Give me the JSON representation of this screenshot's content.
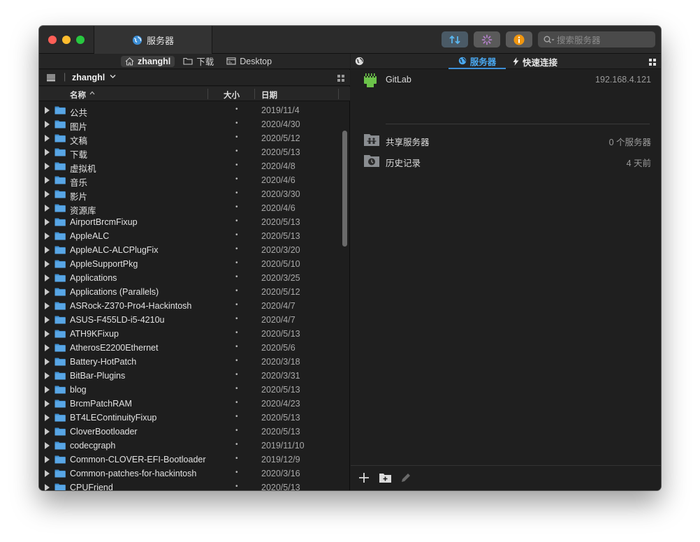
{
  "window": {
    "tab_title": "服务器",
    "search_placeholder": "搜索服务器"
  },
  "left": {
    "favorites": [
      {
        "label": "zhanghl",
        "icon": "home-icon",
        "active": true
      },
      {
        "label": "下载",
        "icon": "folder-icon",
        "active": false
      },
      {
        "label": "Desktop",
        "icon": "desktop-icon",
        "active": false
      }
    ],
    "path_user": "zhanghl",
    "columns": {
      "name": "名称",
      "size": "大小",
      "date": "日期"
    },
    "rows": [
      {
        "name": "公共",
        "size": "•",
        "date": "2019/11/4"
      },
      {
        "name": "图片",
        "size": "•",
        "date": "2020/4/30"
      },
      {
        "name": "文稿",
        "size": "•",
        "date": "2020/5/12"
      },
      {
        "name": "下载",
        "size": "•",
        "date": "2020/5/13"
      },
      {
        "name": "虚拟机",
        "size": "•",
        "date": "2020/4/8"
      },
      {
        "name": "音乐",
        "size": "•",
        "date": "2020/4/6"
      },
      {
        "name": "影片",
        "size": "•",
        "date": "2020/3/30"
      },
      {
        "name": "资源库",
        "size": "•",
        "date": "2020/4/6"
      },
      {
        "name": "AirportBrcmFixup",
        "size": "•",
        "date": "2020/5/13"
      },
      {
        "name": "AppleALC",
        "size": "•",
        "date": "2020/5/13"
      },
      {
        "name": "AppleALC-ALCPlugFix",
        "size": "•",
        "date": "2020/3/20"
      },
      {
        "name": "AppleSupportPkg",
        "size": "•",
        "date": "2020/5/10"
      },
      {
        "name": "Applications",
        "size": "•",
        "date": "2020/3/25"
      },
      {
        "name": "Applications (Parallels)",
        "size": "•",
        "date": "2020/5/12"
      },
      {
        "name": "ASRock-Z370-Pro4-Hackintosh",
        "size": "•",
        "date": "2020/4/7"
      },
      {
        "name": "ASUS-F455LD-i5-4210u",
        "size": "•",
        "date": "2020/4/7"
      },
      {
        "name": "ATH9KFixup",
        "size": "•",
        "date": "2020/5/13"
      },
      {
        "name": "AtherosE2200Ethernet",
        "size": "•",
        "date": "2020/5/6"
      },
      {
        "name": "Battery-HotPatch",
        "size": "•",
        "date": "2020/3/18"
      },
      {
        "name": "BitBar-Plugins",
        "size": "•",
        "date": "2020/3/31"
      },
      {
        "name": "blog",
        "size": "•",
        "date": "2020/5/13"
      },
      {
        "name": "BrcmPatchRAM",
        "size": "•",
        "date": "2020/4/23"
      },
      {
        "name": "BT4LEContinuityFixup",
        "size": "•",
        "date": "2020/5/13"
      },
      {
        "name": "CloverBootloader",
        "size": "•",
        "date": "2020/5/13"
      },
      {
        "name": "codecgraph",
        "size": "•",
        "date": "2019/11/10"
      },
      {
        "name": "Common-CLOVER-EFI-Bootloader",
        "size": "•",
        "date": "2019/12/9"
      },
      {
        "name": "Common-patches-for-hackintosh",
        "size": "•",
        "date": "2020/3/16"
      },
      {
        "name": "CPUFriend",
        "size": "•",
        "date": "2020/5/13"
      }
    ]
  },
  "right": {
    "tabs": [
      {
        "label": "服务器",
        "active": true
      },
      {
        "label": "快速连接",
        "active": false
      }
    ],
    "server": {
      "name": "GitLab",
      "address": "192.168.4.121"
    },
    "entries": [
      {
        "label": "共享服务器",
        "value": "0 个服务器",
        "icon": "shared-servers-icon"
      },
      {
        "label": "历史记录",
        "value": "4 天前",
        "icon": "history-icon"
      }
    ]
  },
  "colors": {
    "accent": "#4aa8f0",
    "folder": "#3e8ed0",
    "server_icon": "#6cc24a"
  }
}
